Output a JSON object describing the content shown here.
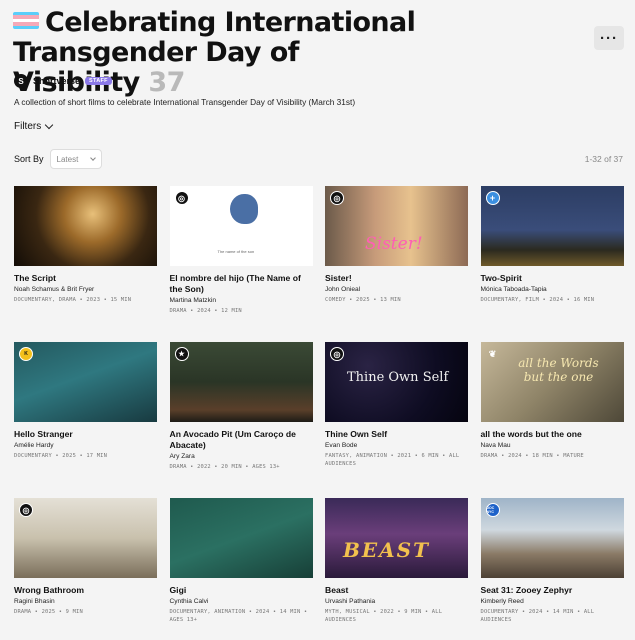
{
  "header": {
    "title": "Celebrating International Transgender Day of Visibility",
    "count": "37",
    "more_label": "···",
    "flag_colors": [
      "#5bcefa",
      "#f5a9b8",
      "#ffffff",
      "#f5a9b8",
      "#5bcefa"
    ]
  },
  "owner": {
    "name": "Shortverse",
    "badge": "STAFF",
    "avatar_letter": "S"
  },
  "description": "A collection of short films to celebrate International Transgender Day of Visibility (March 31st)",
  "filters_label": "Filters",
  "sort": {
    "label": "Sort By",
    "value": "Latest"
  },
  "range": "1-32 of 37",
  "films": [
    {
      "title": "The Script",
      "author": "Noah Schamus & Brit Fryer",
      "meta": "DOCUMENTARY, DRAMA • 2023 • 15 MIN",
      "thumb": "amber",
      "badge": ""
    },
    {
      "title": "El nombre del hijo (The Name of the Son)",
      "author": "Martina Matzkin",
      "meta": "DRAMA • 2024 • 12 MIN",
      "thumb": "white",
      "badge": "award",
      "thumb_caption": "The name of the son"
    },
    {
      "title": "Sister!",
      "author": "John Onieal",
      "meta": "COMEDY • 2025 • 13 MIN",
      "thumb": "sister",
      "badge": "award",
      "overlay": "Sister!"
    },
    {
      "title": "Two-Spirit",
      "author": "Mónica Taboada-Tapia",
      "meta": "DOCUMENTARY, FILM • 2024 • 16 MIN",
      "thumb": "night",
      "badge": "plus"
    },
    {
      "title": "Hello Stranger",
      "author": "Amélie Hardy",
      "meta": "DOCUMENTARY • 2025 • 17 MIN",
      "thumb": "teal",
      "badge": "yellow"
    },
    {
      "title": "An Avocado Pit (Um Caroço de Abacate)",
      "author": "Ary Zara",
      "meta": "DRAMA • 2022 • 20 MIN • AGES 13+",
      "thumb": "green",
      "badge": "star"
    },
    {
      "title": "Thine Own Self",
      "author": "Evan Bode",
      "meta": "FANTASY, ANIMATION • 2021 • 6 MIN • ALL AUDIENCES",
      "thumb": "sparkle",
      "badge": "award",
      "overlay": "Thine Own Self"
    },
    {
      "title": "all the words but the one",
      "author": "Nava Mau",
      "meta": "DRAMA • 2024 • 18 MIN • MATURE",
      "thumb": "sepia",
      "badge": "laurel",
      "overlay": "all the Words but the one"
    },
    {
      "title": "Wrong Bathroom",
      "author": "Ragini Bhasin",
      "meta": "DRAMA • 2025 • 9 MIN",
      "thumb": "bath",
      "badge": "award"
    },
    {
      "title": "Gigi",
      "author": "Cynthia Calvi",
      "meta": "DOCUMENTARY, ANIMATION • 2024 • 14 MIN • AGES 13+",
      "thumb": "anim",
      "badge": ""
    },
    {
      "title": "Beast",
      "author": "Urvashi Pathania",
      "meta": "MYTH, MUSICAL • 2022 • 9 MIN • ALL AUDIENCES",
      "thumb": "beast",
      "badge": "",
      "overlay": "BEAST"
    },
    {
      "title": "Seat 31: Zooey Zephyr",
      "author": "Kimberly Reed",
      "meta": "DOCUMENTARY • 2024 • 14 MIN • ALL AUDIENCES",
      "thumb": "street",
      "badge": "docnyc",
      "badge_text": "DOC NYC"
    }
  ]
}
